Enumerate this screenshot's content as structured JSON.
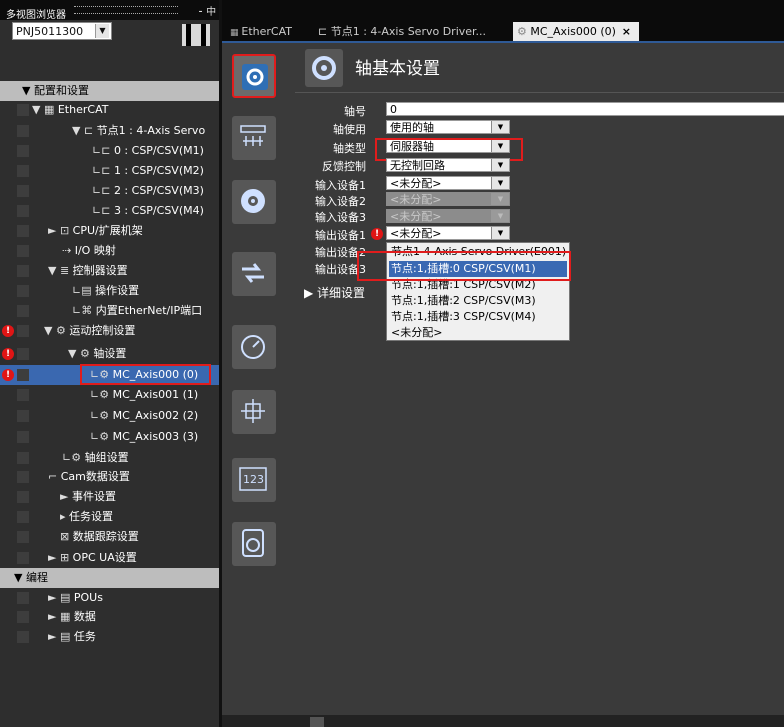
{
  "left_panel": {
    "title": "多视图浏览器",
    "pin_icon": "⁃ 中",
    "device_name": "PNJ5011300",
    "tree": [
      {
        "label": "配置和设置",
        "kind": "section"
      },
      {
        "label": "EtherCAT",
        "kind": "item"
      },
      {
        "label": "节点1 : 4-Axis Servo",
        "kind": "item"
      },
      {
        "label": "0 : CSP/CSV(M1)",
        "kind": "item"
      },
      {
        "label": "1 : CSP/CSV(M2)",
        "kind": "item"
      },
      {
        "label": "2 : CSP/CSV(M3)",
        "kind": "item"
      },
      {
        "label": "3 : CSP/CSV(M4)",
        "kind": "item"
      },
      {
        "label": "CPU/扩展机架",
        "kind": "item"
      },
      {
        "label": "I/O 映射",
        "kind": "item"
      },
      {
        "label": "控制器设置",
        "kind": "item"
      },
      {
        "label": "操作设置",
        "kind": "item"
      },
      {
        "label": "内置EtherNet/IP端口",
        "kind": "item"
      },
      {
        "label": "运动控制设置",
        "kind": "item",
        "warn": true
      },
      {
        "label": "轴设置",
        "kind": "item",
        "warn": true
      },
      {
        "label": "MC_Axis000 (0)",
        "kind": "item",
        "warn": true,
        "selected": true
      },
      {
        "label": "MC_Axis001 (1)",
        "kind": "item"
      },
      {
        "label": "MC_Axis002 (2)",
        "kind": "item"
      },
      {
        "label": "MC_Axis003 (3)",
        "kind": "item"
      },
      {
        "label": "轴组设置",
        "kind": "item"
      },
      {
        "label": "Cam数据设置",
        "kind": "item"
      },
      {
        "label": "事件设置",
        "kind": "item"
      },
      {
        "label": "任务设置",
        "kind": "item"
      },
      {
        "label": "数据跟踪设置",
        "kind": "item"
      },
      {
        "label": "OPC UA设置",
        "kind": "item"
      },
      {
        "label": "编程",
        "kind": "section"
      },
      {
        "label": "POUs",
        "kind": "item"
      },
      {
        "label": "数据",
        "kind": "item"
      },
      {
        "label": "任务",
        "kind": "item"
      }
    ]
  },
  "tabs": [
    {
      "label": "EtherCAT"
    },
    {
      "label": "节点1 : 4-Axis Servo Driver..."
    },
    {
      "label": "MC_Axis000 (0)",
      "close": "×"
    }
  ],
  "side_icons": [
    "axis-basic-settings-icon",
    "units-conversion-icon",
    "operation-settings-icon",
    "other-operation-settings-icon",
    "limit-settings-icon",
    "homing-settings-icon",
    "position-count-settings-icon",
    "servo-drive-settings-icon"
  ],
  "page_title": "轴基本设置",
  "form": {
    "axis_number_label": "轴号",
    "axis_number": "0",
    "axis_use_label": "轴使用",
    "axis_use": "使用的轴",
    "axis_type_label": "轴类型",
    "axis_type": "伺服器轴",
    "feedback_label": "反馈控制",
    "feedback": "无控制回路",
    "in1_label": "输入设备1",
    "in1": "<未分配>",
    "in2_label": "输入设备2",
    "in2": "<未分配>",
    "in3_label": "输入设备3",
    "in3": "<未分配>",
    "out1_label": "输出设备1",
    "out1": "<未分配>",
    "out2_label": "输出设备2",
    "out3_label": "输出设备3",
    "detail_label": "▶ 详细设置"
  },
  "dropdown_options": [
    "节点1 4-Axis Servo Driver(E001)",
    "节点:1,插槽:0 CSP/CSV(M1)",
    "节点:1,插槽:1 CSP/CSV(M2)",
    "节点:1,插槽:2 CSP/CSV(M3)",
    "节点:1,插槽:3 CSP/CSV(M4)",
    "<未分配>"
  ],
  "accent_color": "#e01c1c"
}
